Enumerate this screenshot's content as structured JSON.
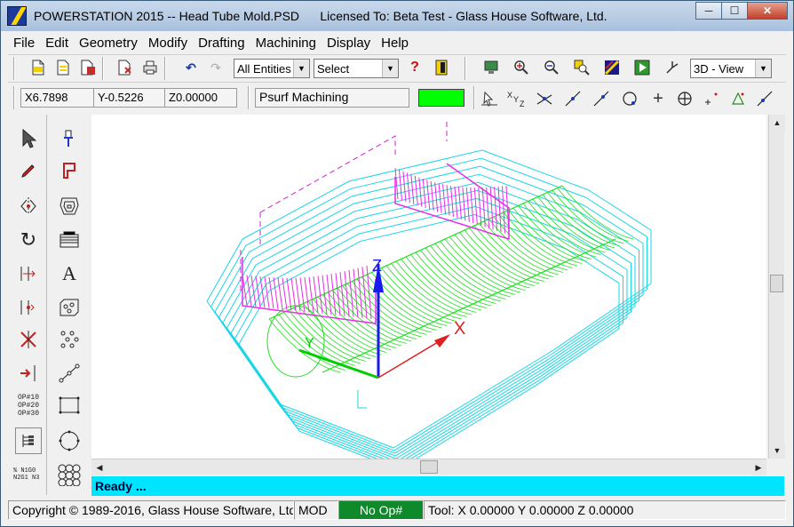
{
  "window": {
    "title": "POWERSTATION 2015 -- Head Tube Mold.PSD      Licensed To: Beta Test - Glass House Software, Ltd.",
    "minimize": "─",
    "maximize": "☐",
    "close": "✕"
  },
  "menu": [
    "File",
    "Edit",
    "Geometry",
    "Modify",
    "Drafting",
    "Machining",
    "Display",
    "Help"
  ],
  "toolbar": {
    "entity_filter": "All Entities",
    "select_mode": "Select",
    "view_mode": "3D - View",
    "help_glyph": "?"
  },
  "coords": {
    "x": "X6.7898",
    "y": "Y-0.5226",
    "z": "Z0.00000"
  },
  "operation_field": "Psurf Machining",
  "active_color": "#00ff00",
  "axis_labels": {
    "x": "X",
    "y": "Y",
    "z": "Z"
  },
  "left_tools": {
    "text_tool": "A",
    "ops_list_icon": "OP#10 OP#20 OP#30",
    "nc_code_icon": "% N1G0 N2G1 N3"
  },
  "prompt": "Ready ...",
  "status": {
    "copyright": "Copyright © 1989-2016, Glass House Software, Ltd.",
    "mode": "MOD",
    "op": "No Op#",
    "tool": "Tool: X 0.00000 Y 0.00000 Z 0.00000"
  },
  "colors": {
    "toolpath_cyan": "#19d6e6",
    "surface_green": "#22dd22",
    "surface_magenta": "#e62ee6",
    "axis_x": "#e02020",
    "axis_y": "#00cc00",
    "axis_z": "#1a1aee",
    "prompt_bg": "#00e5ff",
    "op_bg": "#0f8a2a"
  },
  "icons": [
    "app-logo-icon",
    "new-file-icon",
    "open-file-icon",
    "save-file-icon",
    "print-setup-icon",
    "print-icon",
    "undo-icon",
    "redo-icon",
    "help-icon",
    "exit-icon",
    "display-icon",
    "zoom-in-icon",
    "zoom-out-icon",
    "zoom-window-icon",
    "render-icon",
    "play-icon",
    "rotate-view-icon",
    "select-arrow-icon",
    "pencil-icon",
    "mirror-icon",
    "rotate-icon",
    "offset-icon",
    "trim-icon",
    "extend-icon",
    "ops-list-icon",
    "nc-code-icon",
    "toolpath-icon",
    "contour-icon",
    "pocket-icon",
    "text-icon",
    "drill-pattern-icon",
    "point-grid-icon",
    "line-icon",
    "rectangle-icon",
    "circle-icon",
    "select-entity-icon",
    "xyz-icon",
    "intersect-icon",
    "line-angle-icon",
    "arc-icon",
    "circle-center-icon",
    "plus-icon",
    "circle-cross-icon",
    "point-icon",
    "triangle-icon",
    "tangent-icon"
  ]
}
